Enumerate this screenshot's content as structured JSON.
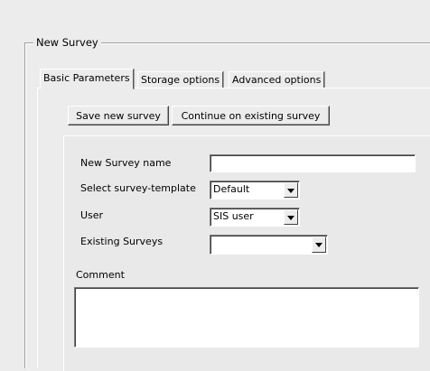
{
  "group": {
    "title": "New Survey"
  },
  "tabs": [
    {
      "label": "Basic Parameters",
      "active": true
    },
    {
      "label": "Storage options",
      "active": false
    },
    {
      "label": "Advanced options",
      "active": false
    }
  ],
  "buttons": {
    "save_new": "Save new survey",
    "continue_existing": "Continue on existing survey"
  },
  "form": {
    "name_label": "New Survey name",
    "name_value": "",
    "template_label": "Select survey-template",
    "template_value": "Default",
    "user_label": "User",
    "user_value": "SIS user",
    "existing_label": "Existing Surveys",
    "existing_value": "",
    "comment_label": "Comment",
    "comment_value": ""
  }
}
